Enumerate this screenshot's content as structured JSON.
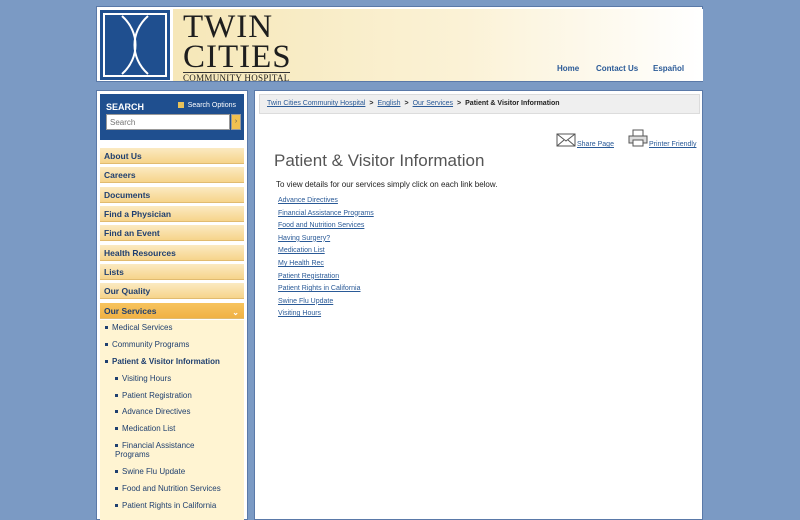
{
  "header": {
    "logo_line1": "TWIN",
    "logo_line2": "CITIES",
    "logo_line3": "COMMUNITY HOSPITAL",
    "nav": [
      "Home",
      "Contact Us",
      "Español"
    ]
  },
  "search": {
    "title": "SEARCH",
    "options_label": "Search Options",
    "placeholder": "Search",
    "go_label": "›"
  },
  "sidebar": {
    "items": [
      {
        "label": "About Us"
      },
      {
        "label": "Careers"
      },
      {
        "label": "Documents"
      },
      {
        "label": "Find a Physician"
      },
      {
        "label": "Find an Event"
      },
      {
        "label": "Health Resources"
      },
      {
        "label": "Lists"
      },
      {
        "label": "Our Quality"
      },
      {
        "label": "Our Services",
        "active": true
      }
    ],
    "sub_items": [
      {
        "label": "Medical Services",
        "level": 1
      },
      {
        "label": "Community Programs",
        "level": 1
      },
      {
        "label": "Patient & Visitor Information",
        "level": 1,
        "current": true
      },
      {
        "label": "Visiting Hours",
        "level": 2
      },
      {
        "label": "Patient Registration",
        "level": 2
      },
      {
        "label": "Advance Directives",
        "level": 2
      },
      {
        "label": "Medication List",
        "level": 2
      },
      {
        "label": "Financial Assistance Programs",
        "level": 2
      },
      {
        "label": "Swine Flu Update",
        "level": 2
      },
      {
        "label": "Food and Nutrition Services",
        "level": 2
      },
      {
        "label": "Patient Rights in California",
        "level": 2
      }
    ]
  },
  "breadcrumb": {
    "items": [
      "Twin Cities Community Hospital",
      "English",
      "Our Services"
    ],
    "current": "Patient & Visitor Information",
    "separator": ">"
  },
  "tools": {
    "share": "Share Page",
    "print": "Printer Friendly"
  },
  "main": {
    "title": "Patient & Visitor Information",
    "intro": "To view details for our services simply click on each link below.",
    "links": [
      "Advance Directives",
      "Financial Assistance Programs",
      "Food and Nutrition Services",
      "Having Surgery?",
      "Medication List",
      "My Health Rec",
      "Patient Registration",
      "Patient Rights in California",
      "Swine Flu Update",
      "Visiting Hours"
    ]
  },
  "colors": {
    "background": "#7b9ac4",
    "brand_blue": "#1f4f8f",
    "link": "#2a5a97",
    "nav_gold": "#f6d48b"
  }
}
